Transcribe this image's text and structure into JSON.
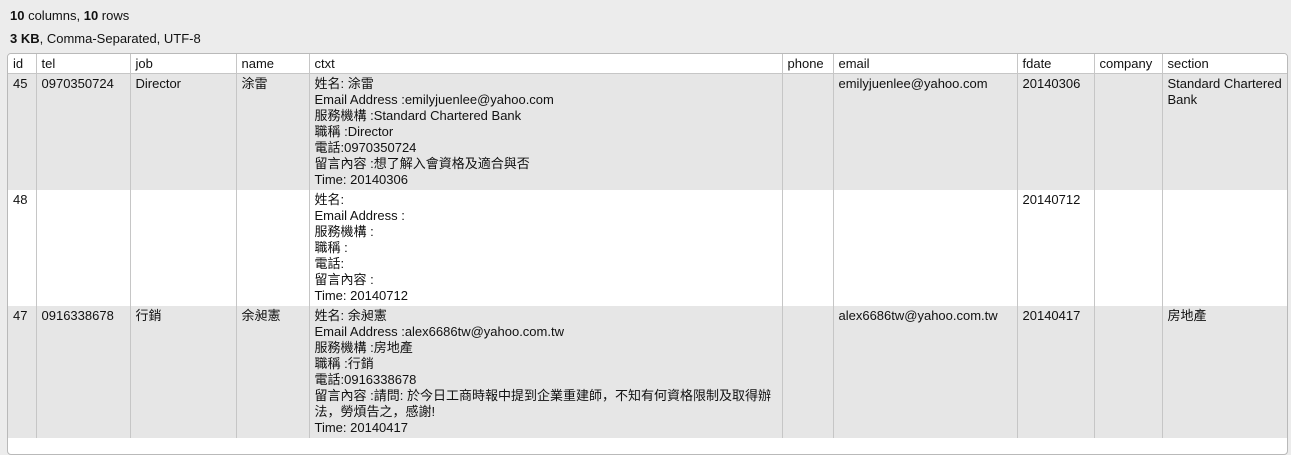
{
  "info": {
    "columns_count": "10",
    "columns_text": " columns, ",
    "rows_count": "10",
    "rows_text": " rows",
    "size": "3 KB",
    "format": ", Comma-Separated, UTF-8"
  },
  "table": {
    "headers": [
      "id",
      "tel",
      "job",
      "name",
      "ctxt",
      "phone",
      "email",
      "fdate",
      "company",
      "section"
    ],
    "rows": [
      {
        "id": "45",
        "tel": "0970350724",
        "job": "Director",
        "name": "涂雷",
        "ctxt": [
          "姓名: 涂雷",
          "Email Address :emilyjuenlee@yahoo.com",
          "服務機構 :Standard Chartered Bank",
          "職稱 :Director",
          "電話:0970350724",
          "留言內容 :想了解入會資格及適合與否",
          "Time: 20140306"
        ],
        "phone": "",
        "email": "emilyjuenlee@yahoo.com",
        "fdate": "20140306",
        "company": "",
        "section": "Standard Chartered Bank"
      },
      {
        "id": "48",
        "tel": "",
        "job": "",
        "name": "",
        "ctxt": [
          "姓名:",
          "Email Address :",
          "服務機構 :",
          "職稱 :",
          "電話:",
          "留言內容 :",
          "Time: 20140712"
        ],
        "phone": "",
        "email": "",
        "fdate": "20140712",
        "company": "",
        "section": ""
      },
      {
        "id": "47",
        "tel": "0916338678",
        "job": "行銷",
        "name": "余昶憲",
        "ctxt": [
          "姓名: 余昶憲",
          "Email Address :alex6686tw@yahoo.com.tw",
          "服務機構 :房地產",
          "職稱 :行銷",
          "電話:0916338678",
          "留言內容 :請問: 於今日工商時報中提到企業重建師，不知有何資格限制及取得辦法，勞煩告之，感謝!",
          "Time: 20140417"
        ],
        "phone": "",
        "email": "alex6686tw@yahoo.com.tw",
        "fdate": "20140417",
        "company": "",
        "section": "房地產"
      }
    ]
  }
}
